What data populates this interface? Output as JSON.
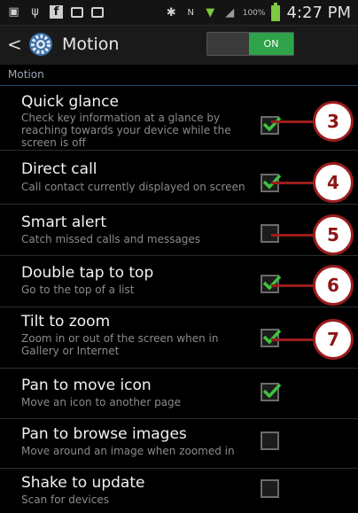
{
  "status_bar": {
    "icons": [
      "sim-icon",
      "usb-icon",
      "facebook-icon",
      "mail-icon",
      "gmail-icon",
      "bluetooth-icon",
      "nfc-icon",
      "wifi-icon",
      "signal-icon"
    ],
    "battery": "100%",
    "time": "4:27 PM"
  },
  "header": {
    "title": "Motion",
    "toggle_label": "ON"
  },
  "section_label": "Motion",
  "settings": [
    {
      "title": "Quick glance",
      "desc": "Check key information at a glance by reaching towards your device while the screen is off",
      "checked": true
    },
    {
      "title": "Direct call",
      "desc": "Call contact currently displayed on screen",
      "checked": true
    },
    {
      "title": "Smart alert",
      "desc": "Catch missed calls and messages",
      "checked": false
    },
    {
      "title": "Double tap to top",
      "desc": "Go to the top of a list",
      "checked": true
    },
    {
      "title": "Tilt to zoom",
      "desc": "Zoom in or out of the screen when in Gallery or Internet",
      "checked": true
    },
    {
      "title": "Pan to move icon",
      "desc": "Move an icon to another page",
      "checked": true
    },
    {
      "title": "Pan to browse images",
      "desc": "Move around an image when zoomed in",
      "checked": false
    },
    {
      "title": "Shake to update",
      "desc": "Scan for devices",
      "checked": false
    }
  ],
  "callouts": [
    "3",
    "4",
    "5",
    "6",
    "7"
  ],
  "colors": {
    "accent_check": "#3ec43e",
    "toggle_on": "#2ea34a",
    "callout": "#9b1c1c"
  }
}
